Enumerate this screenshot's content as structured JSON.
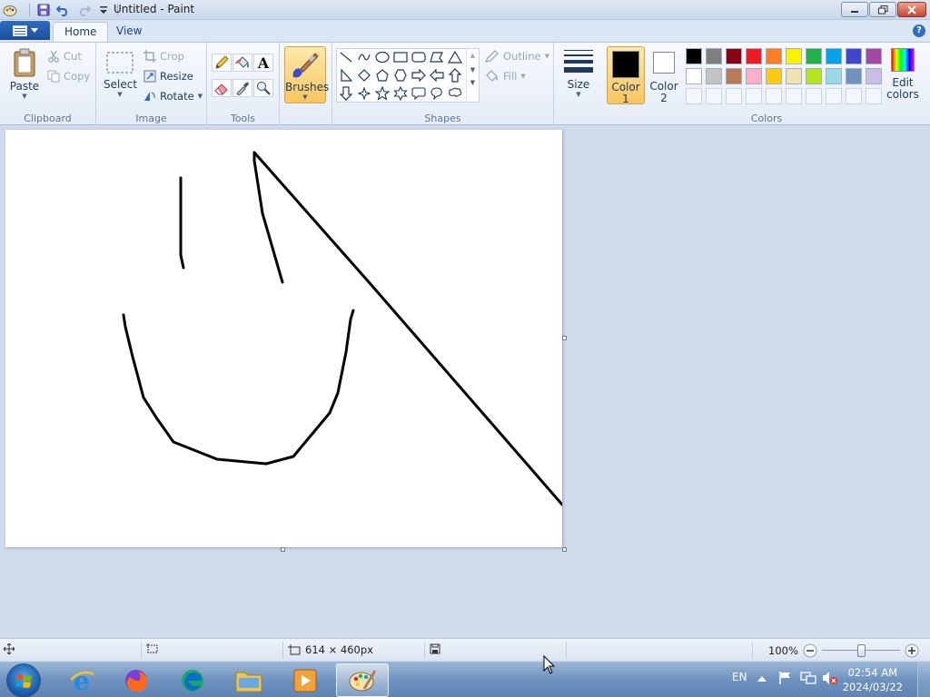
{
  "window": {
    "title": "Untitled - Paint"
  },
  "tabs": [
    {
      "label": "Home"
    },
    {
      "label": "View"
    }
  ],
  "help_label": "?",
  "clipboard": {
    "paste": "Paste",
    "cut": "Cut",
    "copy": "Copy",
    "group_label": "Clipboard"
  },
  "image": {
    "select": "Select",
    "crop": "Crop",
    "resize": "Resize",
    "rotate": "Rotate",
    "group_label": "Image"
  },
  "tools": {
    "group_label": "Tools",
    "text_tool_glyph": "A"
  },
  "brushes": {
    "label": "Brushes"
  },
  "shapes": {
    "outline": "Outline",
    "fill": "Fill",
    "group_label": "Shapes"
  },
  "size": {
    "label": "Size"
  },
  "colors": {
    "color1_label": "Color",
    "color1_num": "1",
    "color2_label": "Color",
    "color2_num": "2",
    "edit_label": "Edit",
    "edit_label2": "colors",
    "group_label": "Colors",
    "color1_value": "#000000",
    "color2_value": "#ffffff",
    "palette_row1": [
      "#000000",
      "#7f7f7f",
      "#880015",
      "#ed1c24",
      "#ff7f27",
      "#fff200",
      "#22b14c",
      "#00a2e8",
      "#3f48cc",
      "#a349a4"
    ],
    "palette_row2": [
      "#ffffff",
      "#c3c3c3",
      "#b97a57",
      "#ffaec9",
      "#ffc90e",
      "#efe4b0",
      "#b5e61d",
      "#99d9ea",
      "#7092be",
      "#c8bfe7"
    ]
  },
  "statusbar": {
    "dimensions": "614 × 460px",
    "zoom": "100%",
    "zoom_fraction": 0.5
  },
  "taskbar": {
    "language": "EN",
    "time": "02:54 AM",
    "date": "2024/03/22"
  }
}
